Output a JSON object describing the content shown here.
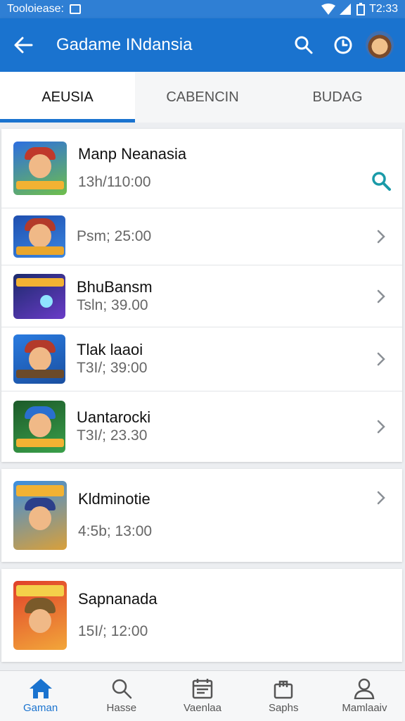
{
  "status_bar": {
    "left_text": "Tooloiease:",
    "right_text": "T2:33"
  },
  "app_bar": {
    "title": "Gadame INdansia"
  },
  "tabs": [
    {
      "label": "AEUSIA",
      "active": true
    },
    {
      "label": "CABENCIN",
      "active": false
    },
    {
      "label": "BUDAG",
      "active": false
    }
  ],
  "cards": [
    {
      "items": [
        {
          "name": "Manp Neanasia",
          "time": "13h/110:00",
          "action": "search-icon"
        },
        {
          "name": "",
          "time": "Psm; 25:00",
          "action": "chevron-right-icon"
        },
        {
          "name": "BhuBansm",
          "time": "Tsln; 39.00",
          "action": "chevron-right-icon"
        },
        {
          "name": "Tlak laaoi",
          "time": "T3I/; 39:00",
          "action": "chevron-right-icon"
        },
        {
          "name": "Uantarocki",
          "time": "T3I/; 23.30",
          "action": "chevron-right-icon"
        }
      ]
    },
    {
      "items": [
        {
          "name": "Kldminotie",
          "time": "4:5b; 13:00",
          "action": "chevron-right-icon"
        }
      ]
    },
    {
      "items": [
        {
          "name": "Sapnanada",
          "time": "15I/; 12:00",
          "action": ""
        }
      ]
    }
  ],
  "bottom_nav": [
    {
      "label": "Gaman",
      "icon": "home-icon",
      "active": true
    },
    {
      "label": "Hasse",
      "icon": "search-icon",
      "active": false
    },
    {
      "label": "Vaenlaa",
      "icon": "calendar-icon",
      "active": false
    },
    {
      "label": "Saphs",
      "icon": "shopping-bag-icon",
      "active": false
    },
    {
      "label": "Mamlaaiv",
      "icon": "person-icon",
      "active": false
    }
  ],
  "colors": {
    "primary": "#1a73cf",
    "status_bar": "#2f7fd4",
    "search_accent": "#1a9aa8"
  }
}
